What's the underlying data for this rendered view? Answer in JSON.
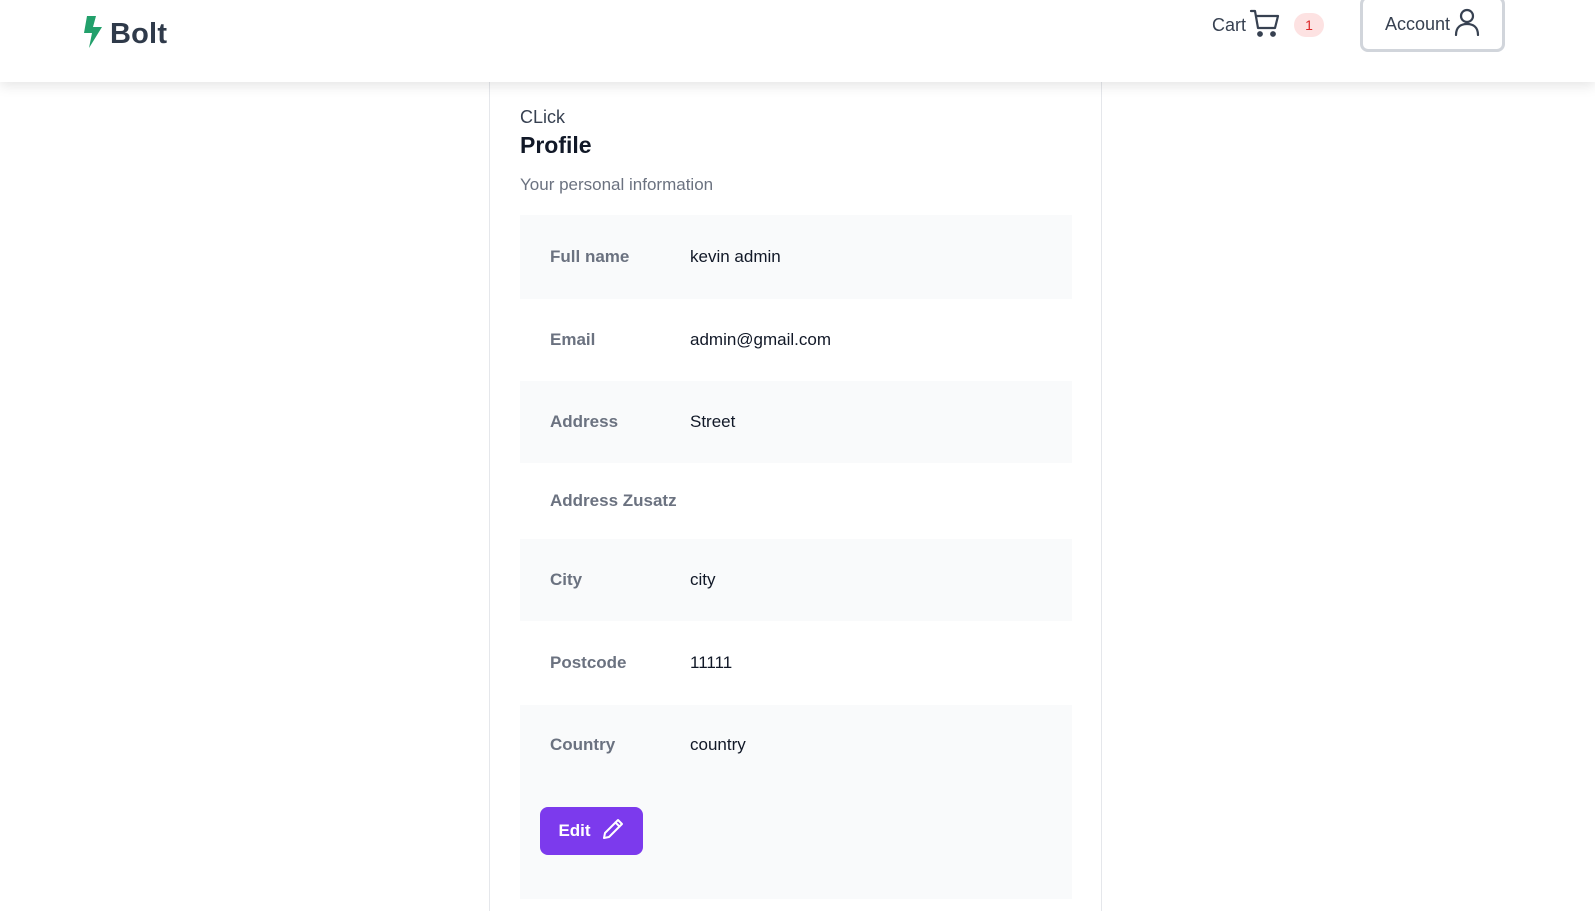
{
  "brand": {
    "name": "Bolt",
    "accent": "#22a06b"
  },
  "nav": {
    "cart_label": "Cart",
    "cart_count": "1",
    "account_label": "Account"
  },
  "profile": {
    "pretitle": "CLick",
    "title": "Profile",
    "subtitle": "Your personal information",
    "fields": [
      {
        "label": "Full name",
        "value": "kevin admin"
      },
      {
        "label": "Email",
        "value": "admin@gmail.com"
      },
      {
        "label": "Address",
        "value": "Street"
      },
      {
        "label": "Address Zusatz",
        "value": ""
      },
      {
        "label": "City",
        "value": "city"
      },
      {
        "label": "Postcode",
        "value": "11111"
      },
      {
        "label": "Country",
        "value": "country"
      }
    ],
    "edit_label": "Edit"
  },
  "colors": {
    "button": "#7c3aed",
    "badge_bg": "#fde2e2",
    "badge_text": "#dc2626"
  }
}
